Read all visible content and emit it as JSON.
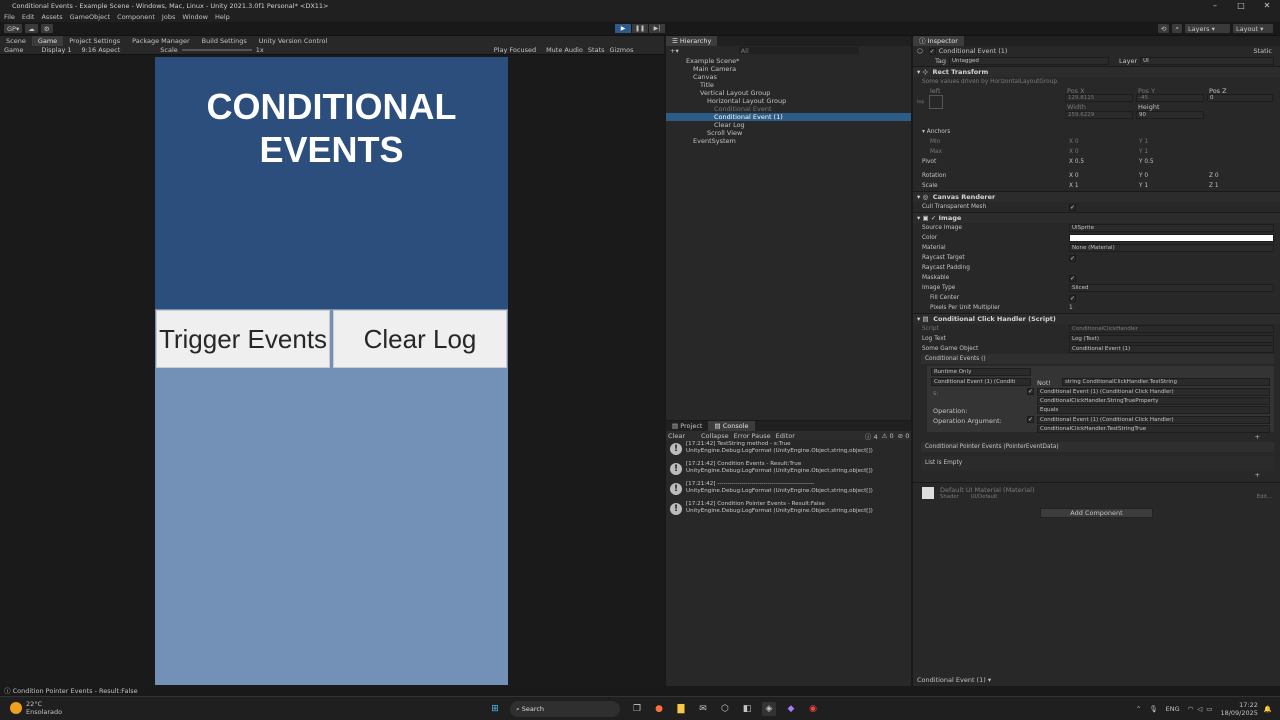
{
  "window": {
    "title": "Conditional Events - Example Scene - Windows, Mac, Linux - Unity 2021.3.0f1 Personal* <DX11>"
  },
  "menu": [
    "File",
    "Edit",
    "Assets",
    "GameObject",
    "Component",
    "Jobs",
    "Window",
    "Help"
  ],
  "toolbar": {
    "account": "GP",
    "layers": "Layers",
    "layout": "Layout"
  },
  "game_tabs": [
    "Scene",
    "Game",
    "Project Settings",
    "Package Manager",
    "Build Settings",
    "Unity Version Control"
  ],
  "gamebar": {
    "game": "Game",
    "display": "Display 1",
    "aspect": "9:16 Aspect",
    "scale": "Scale",
    "scale_val": "1x",
    "play_focused": "Play Focused",
    "mute": "Mute Audio",
    "stats": "Stats",
    "gizmos": "Gizmos"
  },
  "game": {
    "title": "CONDITIONAL\nEVENTS",
    "trigger": "Trigger Events",
    "clear": "Clear Log"
  },
  "hierarchy": {
    "tab": "Hierarchy",
    "search": "All",
    "items": [
      {
        "label": "Example Scene*",
        "indent": 0
      },
      {
        "label": "Main Camera",
        "indent": 1
      },
      {
        "label": "Canvas",
        "indent": 1
      },
      {
        "label": "Title",
        "indent": 2
      },
      {
        "label": "Vertical Layout Group",
        "indent": 2
      },
      {
        "label": "Horizontal Layout Group",
        "indent": 3
      },
      {
        "label": "Conditional Event",
        "indent": 4
      },
      {
        "label": "Conditional Event (1)",
        "indent": 4
      },
      {
        "label": "Clear Log",
        "indent": 4
      },
      {
        "label": "Scroll View",
        "indent": 3
      },
      {
        "label": "EventSystem",
        "indent": 1
      }
    ]
  },
  "console": {
    "tabs": [
      "Project",
      "Console"
    ],
    "controls": [
      "Clear",
      "Collapse",
      "Error Pause",
      "Editor"
    ],
    "counts": [
      "4",
      "0",
      "0"
    ],
    "logs": [
      {
        "l1": "[17:21:42] TestString method - s:True",
        "l2": "UnityEngine.Debug:LogFormat (UnityEngine.Object,string,object[])"
      },
      {
        "l1": "[17:21:42] Condition Events - Result:True",
        "l2": "UnityEngine.Debug:LogFormat (UnityEngine.Object,string,object[])"
      },
      {
        "l1": "[17:21:42] ------------------------------------------------",
        "l2": "UnityEngine.Debug:LogFormat (UnityEngine.Object,string,object[])"
      },
      {
        "l1": "[17:21:42] Condition Pointer Events - Result:False",
        "l2": "UnityEngine.Debug:LogFormat (UnityEngine.Object,string,object[])"
      }
    ]
  },
  "inspector": {
    "tab": "Inspector",
    "object": "Conditional Event (1)",
    "static": "Static",
    "tag_label": "Tag",
    "tag": "Untagged",
    "layer_label": "Layer",
    "layer": "UI",
    "rect": "Rect Transform",
    "rect_note": "Some values driven by HorizontalLayoutGroup.",
    "anchor_word": "left",
    "anchor_word2": "top",
    "posx": "Pos X",
    "posy": "Pos Y",
    "posz": "Pos Z",
    "vx": "129.8115",
    "vy": "-45",
    "vz": "0",
    "width": "Width",
    "height": "Height",
    "vw": "259.6229",
    "vh": "90",
    "anchors": "Anchors",
    "min": "Min",
    "max": "Max",
    "pivot": "Pivot",
    "rotation": "Rotation",
    "scale": "Scale",
    "canvas_renderer": "Canvas Renderer",
    "cull": "Cull Transparent Mesh",
    "image": "Image",
    "source_image": "Source Image",
    "sprite": "UISprite",
    "color": "Color",
    "material": "Material",
    "none_mat": "None (Material)",
    "raycast": "Raycast Target",
    "raycast_pad": "Raycast Padding",
    "maskable": "Maskable",
    "image_type": "Image Type",
    "sliced": "Sliced",
    "fill_center": "Fill Center",
    "ppu": "Pixels Per Unit Multiplier",
    "ppu_v": "1",
    "script_comp": "Conditional Click Handler (Script)",
    "script": "Script",
    "script_v": "ConditionalClickHandler",
    "log_text": "Log Text",
    "log_text_v": "Log (Text)",
    "some_go": "Some Game Object",
    "some_go_v": "Conditional Event (1)",
    "cond_events": "Conditional Events ()",
    "runtime": "Runtime Only",
    "cond_obj": "Conditional Event (1) (Conditi",
    "not": "Not!",
    "func1": "string ConditionalClickHandler.TestString",
    "s": "s:",
    "handler1": "Conditional Event (1) (Conditional Click Handler)",
    "func2": "ConditionalClickHandler.StringTrueProperty",
    "operation": "Operation:",
    "equals": "Equals",
    "op_arg": "Operation Argument:",
    "handler2": "Conditional Event (1) (Conditional Click Handler)",
    "func3": "ConditionalClickHandler.TestStringTrue",
    "pointer": "Conditional Pointer Events (PointerEventData)",
    "empty": "List is Empty",
    "mat": "Default UI Material (Material)",
    "shader": "Shader",
    "shader_v": "UI/Default",
    "edit": "Edit...",
    "add_component": "Add Component",
    "footer": "Conditional Event (1)"
  },
  "status": "Condition Pointer Events - Result:False",
  "taskbar": {
    "temp": "22°C",
    "weather": "Ensolarado",
    "search": "Search",
    "lang": "ENG",
    "time": "17:22",
    "date": "18/09/2025"
  }
}
